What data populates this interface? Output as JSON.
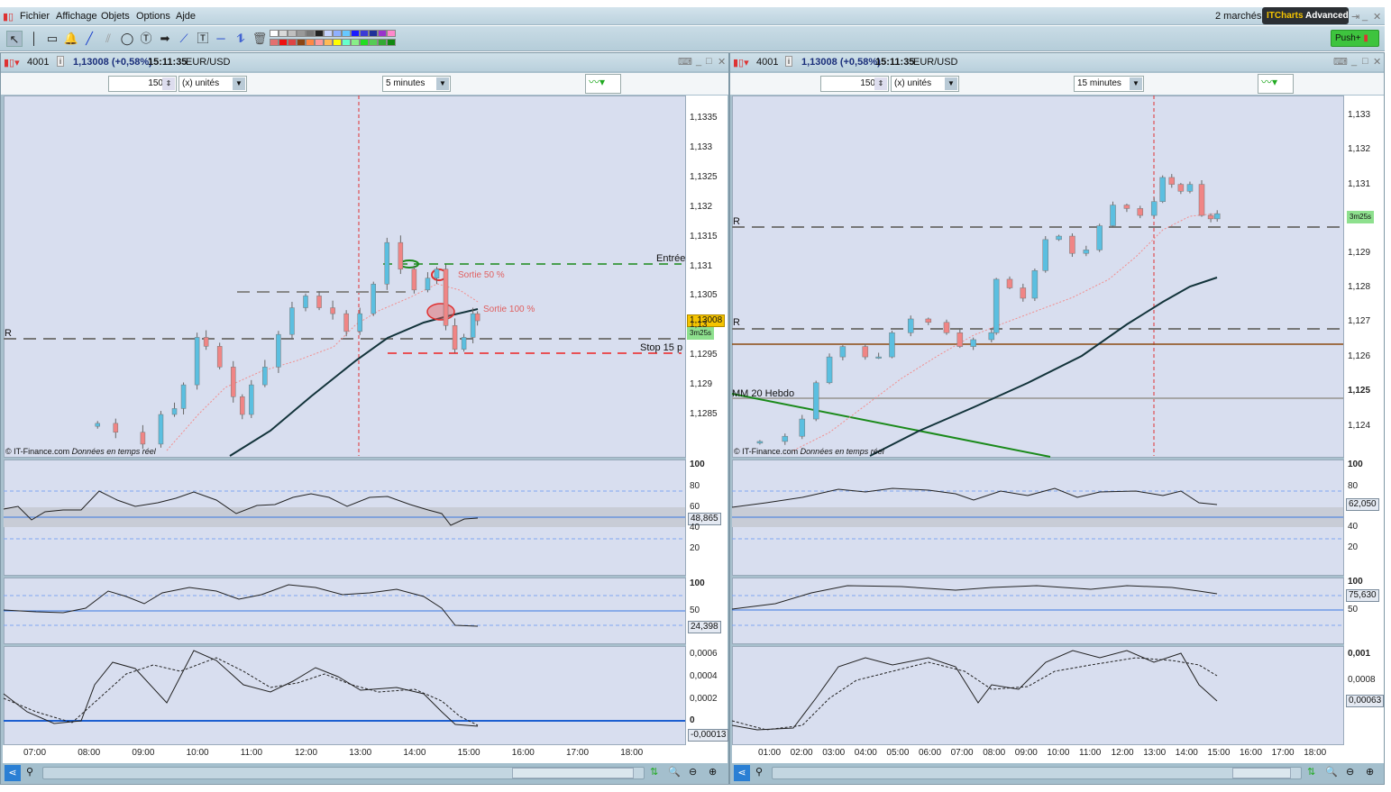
{
  "menu": {
    "items": [
      "Fichier",
      "Affichage",
      "Objets",
      "Options",
      "Ajde"
    ],
    "markets": "2 marchés",
    "brand_a": "ITCharts",
    "brand_b": "Advanced",
    "push_label": "Push+"
  },
  "toolbar": {
    "tools": [
      "pointer",
      "vertical-line",
      "rectangle",
      "alert-bell",
      "trend-line",
      "ruler",
      "ellipse",
      "text-bubble",
      "arrow",
      "segment",
      "text-box",
      "horizontal-line",
      "channel",
      "trash"
    ],
    "palette_row1": [
      "#ffffff",
      "#d9d9d9",
      "#bfbfbf",
      "#999999",
      "#777777",
      "#222222",
      "#c6d4ff",
      "#8fb0ff",
      "#66c8ff",
      "#1a1aff",
      "#3b3bd6",
      "#1f2f99",
      "#9933cc",
      "#ff88cc"
    ],
    "palette_row2": [
      "#e37070",
      "#ee1111",
      "#dd4444",
      "#8b4513",
      "#ff8844",
      "#ff9999",
      "#ffbb55",
      "#ffff00",
      "#66ffcc",
      "#88ee88",
      "#22dd22",
      "#55cc55",
      "#33aa33",
      "#118811"
    ]
  },
  "left": {
    "id": "4001",
    "price": "1,13008 (+0,58%)",
    "time": "15:11:35",
    "symbol": "EUR/USD",
    "units_value": "150",
    "units_label": "(x) unités",
    "period": "5 minutes",
    "price_ticks": [
      "1,1335",
      "1,133",
      "1,1325",
      "1,132",
      "1,1315",
      "1,131",
      "1,1305",
      "1,13",
      "1,1295",
      "1,129",
      "1,1285"
    ],
    "time_ticks": [
      "07:00",
      "08:00",
      "09:00",
      "10:00",
      "11:00",
      "12:00",
      "13:00",
      "14:00",
      "15:00",
      "16:00",
      "17:00",
      "18:00"
    ],
    "last_price": "1,13008",
    "countdown": "3m25s",
    "copyright": "© IT-Finance.com",
    "realtime": "Données en temps réel",
    "labels": {
      "entry": "Entrée",
      "exit50": "Sortie 50 %",
      "exit100": "Sortie 100 %",
      "stop": "Stop 15 p",
      "r": "R"
    },
    "osc1": {
      "ticks": [
        "100",
        "80",
        "60",
        "40",
        "20"
      ],
      "value": "48,865"
    },
    "osc2": {
      "ticks": [
        "100",
        "50"
      ],
      "value": "24,398"
    },
    "osc3": {
      "ticks": [
        "0,0006",
        "0,0004",
        "0,0002",
        "0"
      ],
      "value": "-0,00013"
    },
    "candles": {
      "times": [
        "08:10",
        "08:30",
        "09:00",
        "09:20",
        "09:35",
        "09:45",
        "10:00",
        "10:10",
        "10:25",
        "10:40",
        "10:50",
        "11:00",
        "11:15",
        "11:30",
        "11:45",
        "12:00",
        "12:15",
        "12:30",
        "12:45",
        "13:00",
        "13:15",
        "13:30",
        "13:45",
        "14:00",
        "14:15",
        "14:25",
        "14:35",
        "14:45",
        "14:55",
        "15:05",
        "15:10"
      ],
      "closes": [
        1.12835,
        1.1282,
        1.128,
        1.1285,
        1.1286,
        1.129,
        1.1298,
        1.12965,
        1.1293,
        1.1288,
        1.1285,
        1.129,
        1.1293,
        1.12985,
        1.1303,
        1.1305,
        1.1303,
        1.1302,
        1.1299,
        1.1302,
        1.1307,
        1.1314,
        1.13095,
        1.1306,
        1.1308,
        1.13095,
        1.13,
        1.1296,
        1.1298,
        1.1302,
        1.13008
      ]
    }
  },
  "right": {
    "id": "4001",
    "price": "1,13008 (+0,58%)",
    "time": "15:11:35",
    "symbol": "EUR/USD",
    "units_value": "150",
    "units_label": "(x) unités",
    "period": "15 minutes",
    "price_ticks": [
      "1,133",
      "1,132",
      "1,131",
      "1,129",
      "1,128",
      "1,127",
      "1,126",
      "1,125",
      "1,124"
    ],
    "time_ticks": [
      "01:00",
      "02:00",
      "03:00",
      "04:00",
      "05:00",
      "06:00",
      "07:00",
      "08:00",
      "09:00",
      "10:00",
      "11:00",
      "12:00",
      "13:00",
      "14:00",
      "15:00",
      "16:00",
      "17:00",
      "18:00"
    ],
    "countdown": "3m25s",
    "copyright": "© IT-Finance.com",
    "realtime": "Données en temps réel",
    "labels": {
      "r": "R",
      "mm20": "MM 20 Hebdo"
    },
    "osc1": {
      "ticks": [
        "100",
        "80",
        "40",
        "20"
      ],
      "value": "62,050"
    },
    "osc2": {
      "ticks": [
        "100",
        "50"
      ],
      "value": "75,630"
    },
    "osc3": {
      "ticks": [
        "0,001",
        "0,0008"
      ],
      "value": "0,00063"
    },
    "candles": {
      "times": [
        "00:43",
        "01:30",
        "02:02",
        "02:28",
        "02:53",
        "03:18",
        "04:00",
        "04:25",
        "04:50",
        "05:25",
        "05:58",
        "06:32",
        "06:57",
        "07:22",
        "07:56",
        "08:05",
        "08:30",
        "08:55",
        "09:17",
        "09:37",
        "10:02",
        "10:27",
        "10:53",
        "11:18",
        "11:43",
        "12:09",
        "12:34",
        "13:00",
        "13:16",
        "13:33",
        "13:50",
        "14:07",
        "14:29",
        "14:46",
        "14:58"
      ],
      "closes": [
        1.12355,
        1.1237,
        1.1242,
        1.12525,
        1.126,
        1.1263,
        1.126,
        1.126,
        1.1267,
        1.1271,
        1.127,
        1.1267,
        1.1263,
        1.1265,
        1.1267,
        1.12825,
        1.128,
        1.1277,
        1.1285,
        1.1294,
        1.1295,
        1.129,
        1.1291,
        1.1298,
        1.1304,
        1.1303,
        1.1301,
        1.1305,
        1.1312,
        1.131,
        1.1308,
        1.131,
        1.1301,
        1.13,
        1.13015
      ]
    }
  },
  "colors": {
    "up": "#5bbfe0",
    "down": "#f08585",
    "chart_bg": "#d8deef"
  }
}
